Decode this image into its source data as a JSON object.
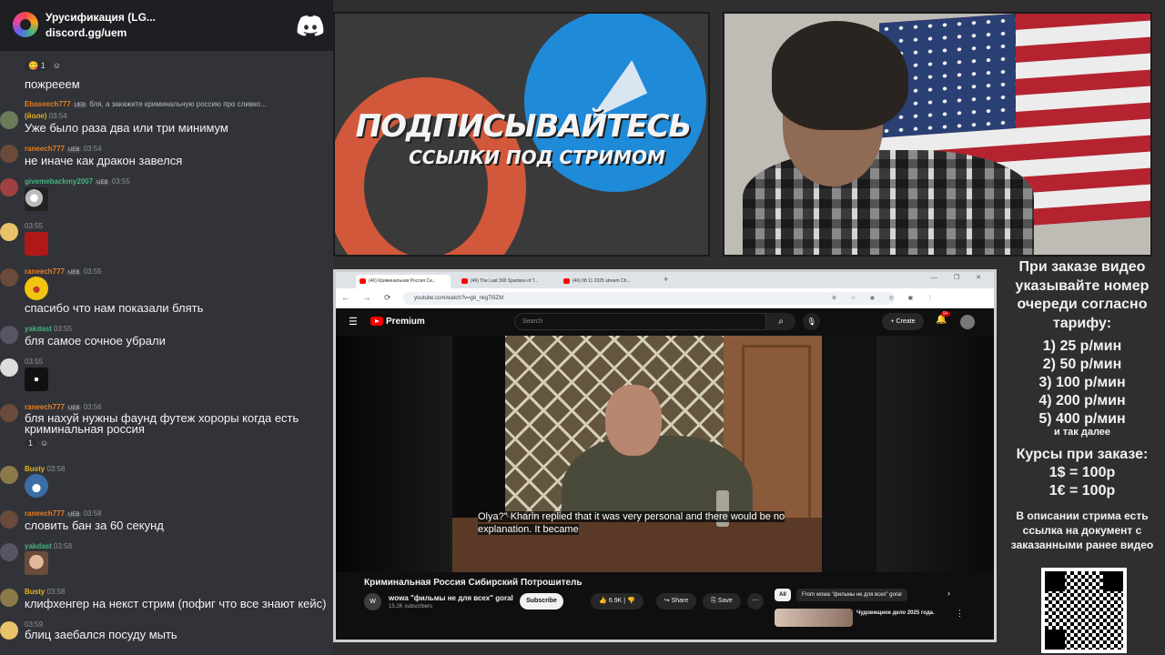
{
  "discord": {
    "server_name": "Урусификация (LG...",
    "invite": "discord.gg/uem",
    "logo_icon": "discord-logo-icon"
  },
  "chat": {
    "messages": [
      {
        "reaction": "😋 1",
        "text": "пожрееем"
      },
      {
        "user": "Ebaseech777",
        "badge": "UEB",
        "reply": "бля, а закажите криминальную россию про сливко...",
        "time": "",
        "text": ""
      },
      {
        "user": "(йоле)",
        "time": "03:54",
        "text": "Уже было раза два или три минимум"
      },
      {
        "user": "raneech777",
        "badge": "UEB",
        "time": "03:54",
        "text": "не иначе как дракон завелся"
      },
      {
        "user": "givemebackmy2007",
        "badge": "UEB",
        "time": "03:55",
        "emote": "troll-face"
      },
      {
        "user": "",
        "time": "03:55",
        "emote": "red-emote"
      },
      {
        "user": "raneech777",
        "badge": "UEB",
        "time": "03:55",
        "emote": "laughing-emote",
        "text": "спасибо что нам показали блять"
      },
      {
        "user": "yakdast",
        "time": "03:55",
        "text": "бля самое сочное убрали"
      },
      {
        "user": "",
        "time": "03:55",
        "emote": "dark-emote"
      },
      {
        "user": "raneech777",
        "badge": "UEB",
        "time": "03:56",
        "text": "бля нахуй нужны фаунд футеж хороры когда есть криминальная россия",
        "reaction": "1"
      },
      {
        "user": "Busty",
        "time": "03:58",
        "emote": "grin-emote"
      },
      {
        "user": "raneech777",
        "badge": "UEB",
        "time": "03:58",
        "text": "словить бан за 60 секунд"
      },
      {
        "user": "yakdast",
        "time": "03:58",
        "emote": "face-emote"
      },
      {
        "user": "Busty",
        "time": "03:58",
        "text": "клифхенгер на некст стрим (пофиг что все знают кейс)"
      },
      {
        "user": "",
        "time": "03:59",
        "text": "блиц заебался посуду мыть"
      }
    ]
  },
  "promo": {
    "title": "ПОДПИСЫВАЙТЕСЬ",
    "subtitle": "ССЫЛКИ ПОД СТРИМОМ"
  },
  "browser": {
    "tabs": [
      "(46) Криминальная Россия Си...",
      "(46) The Last 300 Spartans of T...",
      "(46) 08 11 2025 stream Ch..."
    ],
    "url": "youtube.com/watch?v=gb_nkgTl5ZM"
  },
  "youtube": {
    "brand": "Premium",
    "search_placeholder": "Search",
    "create_label": "Create",
    "notif_badge": "9+",
    "subtitle_line1": "Olya?\" Kharin replied that it was very personal and there would be no",
    "subtitle_line2": "explanation. It became",
    "video_title": "Криминальная Россия Сибирский Потрошитель",
    "channel_initial": "W",
    "channel_name": "wowa \"фильмы не для всех\" goral",
    "subscribers": "15.2K subscribers",
    "subscribe_label": "Subscribe",
    "likes": "6.9K",
    "share_label": "Share",
    "save_label": "Save",
    "chip_all": "All",
    "chip_from": "From wowa \"фильмы не для всех\" goral",
    "rec_title": "Чудовищное дело 2025 года."
  },
  "info": {
    "intro": "При заказе видео указывайте номер очереди согласно тарифу:",
    "prices": [
      "1) 25 р/мин",
      "2) 50 р/мин",
      "3) 100 р/мин",
      "4) 200 р/мин",
      "5) 400 р/мин"
    ],
    "etc": "и так далее",
    "rates_title": "Курсы при заказе:",
    "rates": [
      "1$ = 100р",
      "1€ = 100р"
    ],
    "desc_note": "В описании стрима есть ссылка на документ с заказанными ранее видео"
  }
}
